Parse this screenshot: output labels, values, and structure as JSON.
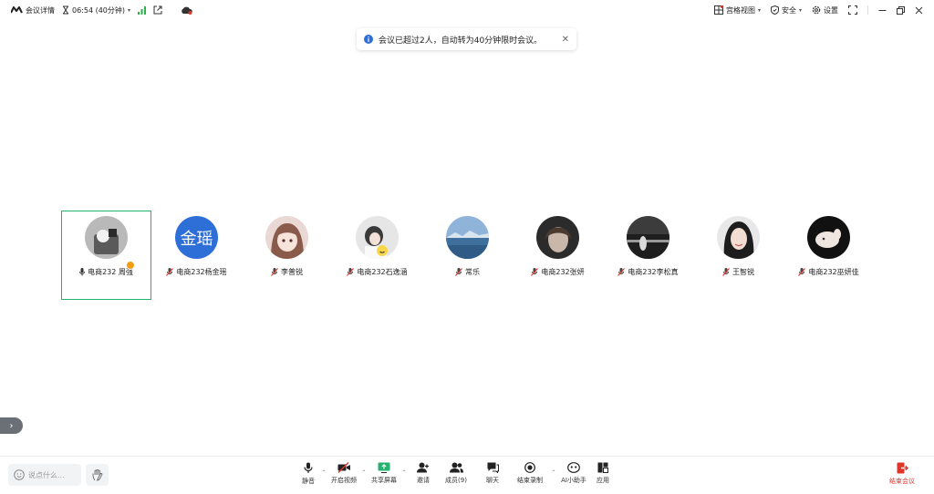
{
  "topbar": {
    "meeting_details": "会议详情",
    "timer": "06:54 (40分钟)",
    "grid_view": "宫格视图",
    "security": "安全",
    "settings": "设置"
  },
  "notice": {
    "text": "会议已超过2人，自动转为40分钟限时会议。"
  },
  "participants": [
    {
      "name": "电商232 周强",
      "avatar_text": "",
      "is_host": true
    },
    {
      "name": "电商232杨金瑶",
      "avatar_text": "金瑶"
    },
    {
      "name": "李普锐",
      "avatar_text": ""
    },
    {
      "name": "电商232石逸涵",
      "avatar_text": ""
    },
    {
      "name": "常乐",
      "avatar_text": ""
    },
    {
      "name": "电商232张妍",
      "avatar_text": ""
    },
    {
      "name": "电商232李松真",
      "avatar_text": ""
    },
    {
      "name": "王智锐",
      "avatar_text": ""
    },
    {
      "name": "电商232巫妍佳",
      "avatar_text": ""
    }
  ],
  "chat": {
    "placeholder": "说点什么..."
  },
  "toolbar": {
    "mute": "静音",
    "video": "开启视频",
    "share": "共享屏幕",
    "invite": "邀请",
    "members": "成员(9)",
    "chat": "聊天",
    "record": "结束录制",
    "ai": "AI小助手",
    "apps": "应用",
    "end": "结束会议"
  },
  "colors": {
    "accent_green": "#23b26d",
    "end_red": "#e0352b",
    "avatar_blue": "#2d6fd6",
    "signal_green": "#2fb24b"
  }
}
